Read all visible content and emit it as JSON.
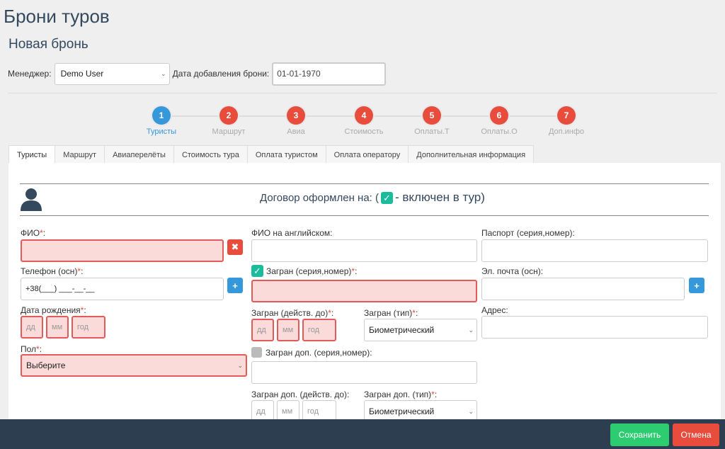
{
  "page": {
    "title": "Брони туров",
    "subtitle": "Новая бронь"
  },
  "meta": {
    "manager_label": "Менеджер:",
    "manager_value": "Demo User",
    "date_label": "Дата добавления брони:",
    "date_value": "01-01-1970"
  },
  "steps": [
    {
      "num": "1",
      "label": "Туристы"
    },
    {
      "num": "2",
      "label": "Маршрут"
    },
    {
      "num": "3",
      "label": "Авиа"
    },
    {
      "num": "4",
      "label": "Стоимость"
    },
    {
      "num": "5",
      "label": "Оплаты.Т"
    },
    {
      "num": "6",
      "label": "Оплаты.О"
    },
    {
      "num": "7",
      "label": "Доп.инфо"
    }
  ],
  "tabs": [
    "Туристы",
    "Маршрут",
    "Авиаперелёты",
    "Стоимость тура",
    "Оплата туристом",
    "Оплата оператору",
    "Дополнительная информация"
  ],
  "contract": {
    "prefix": "Договор оформлен на: (",
    "check": "✓",
    "suffix": " - включен в тур)"
  },
  "form": {
    "required_mark": "*",
    "fio_label": "ФИО",
    "phone_label": "Телефон (осн)",
    "phone_value": "+38(___) ___-__-__",
    "birth_label": "Дата рождения",
    "gender_label": "Пол",
    "gender_value": "Выберите",
    "fio_en_label": "ФИО на английском:",
    "passport_int_label": "Загран (серия,номер)",
    "passport_int_valid_label": "Загран (действ. до)",
    "passport_int_type_label": "Загран (тип)",
    "passport_type_value": "Биометрический",
    "passport_extra_label": "Загран доп. (серия,номер):",
    "passport_extra_valid_label": "Загран доп. (действ. до):",
    "passport_extra_type_label": "Загран доп. (тип)",
    "passport_label": "Паспорт (серия,номер):",
    "email_label": "Эл. почта (осн):",
    "address_label": "Адрес:",
    "ph_day": "дд",
    "ph_month": "мм",
    "ph_year": "год",
    "colon": ":"
  },
  "footer": {
    "save": "Сохранить",
    "cancel": "Отмена"
  },
  "colors": {
    "primary": "#3498db",
    "danger": "#e74c3c",
    "success": "#2ecc71",
    "accent_teal": "#1abc9c",
    "dark": "#2c3e50"
  }
}
